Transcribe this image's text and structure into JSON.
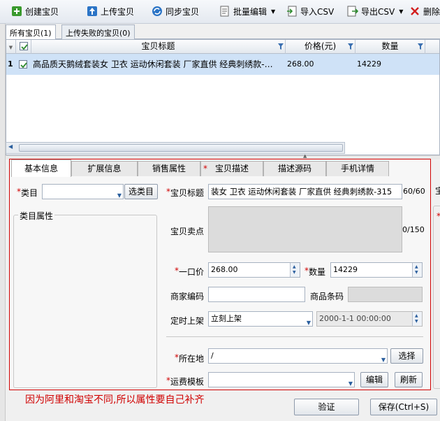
{
  "toolbar": {
    "create": "创建宝贝",
    "upload": "上传宝贝",
    "sync": "同步宝贝",
    "batch_edit": "批量编辑",
    "import_csv": "导入CSV",
    "export_csv": "导出CSV",
    "delete": "删除"
  },
  "list_tabs": {
    "all": "所有宝贝(1)",
    "failed": "上传失败的宝贝(0)"
  },
  "grid": {
    "headers": {
      "title": "宝贝标题",
      "price": "价格(元)",
      "qty": "数量"
    },
    "row": {
      "index": "1",
      "title": "高品质天鹅绒套装女 卫衣 运动休闲套装 厂家直供 经典刺绣款-…",
      "price": "268.00",
      "qty": "14229"
    }
  },
  "edit_tabs": {
    "basic": "基本信息",
    "extended": "扩展信息",
    "sales": "销售属性",
    "desc_star": "*",
    "desc": "宝贝描述",
    "desc_src": "描述源码",
    "mobile": "手机详情"
  },
  "form": {
    "category_label": "类目",
    "choose_category": "选类目",
    "category_attrs": "类目属性",
    "title_label": "宝贝标题",
    "title_value": "装女 卫衣 运动休闲套装 厂家直供 经典刺绣款-315",
    "title_count": "60/60",
    "selling_points_label": "宝贝卖点",
    "selling_points_count": "0/150",
    "price_label": "一口价",
    "price_value": "268.00",
    "qty_label": "数量",
    "qty_value": "14229",
    "merchant_code_label": "商家编码",
    "barcode_label": "商品条码",
    "schedule_label": "定时上架",
    "schedule_value": "立刻上架",
    "schedule_datetime": "2000-1-1 00:00:00",
    "location_label": "所在地",
    "location_value": "/",
    "choose": "选择",
    "shipping_label": "运费模板",
    "edit": "编辑",
    "refresh": "刷新",
    "star": "*"
  },
  "right_stub": {
    "label": "宝",
    "star": "*"
  },
  "note": "因为阿里和淘宝不同,所以属性要自己补齐",
  "footer": {
    "verify": "验证",
    "save": "保存(Ctrl+S)"
  },
  "colors": {
    "accent_red": "#d00000",
    "row_selected": "#cfe2f7",
    "toolbar_blue": "#2b5f9e"
  }
}
